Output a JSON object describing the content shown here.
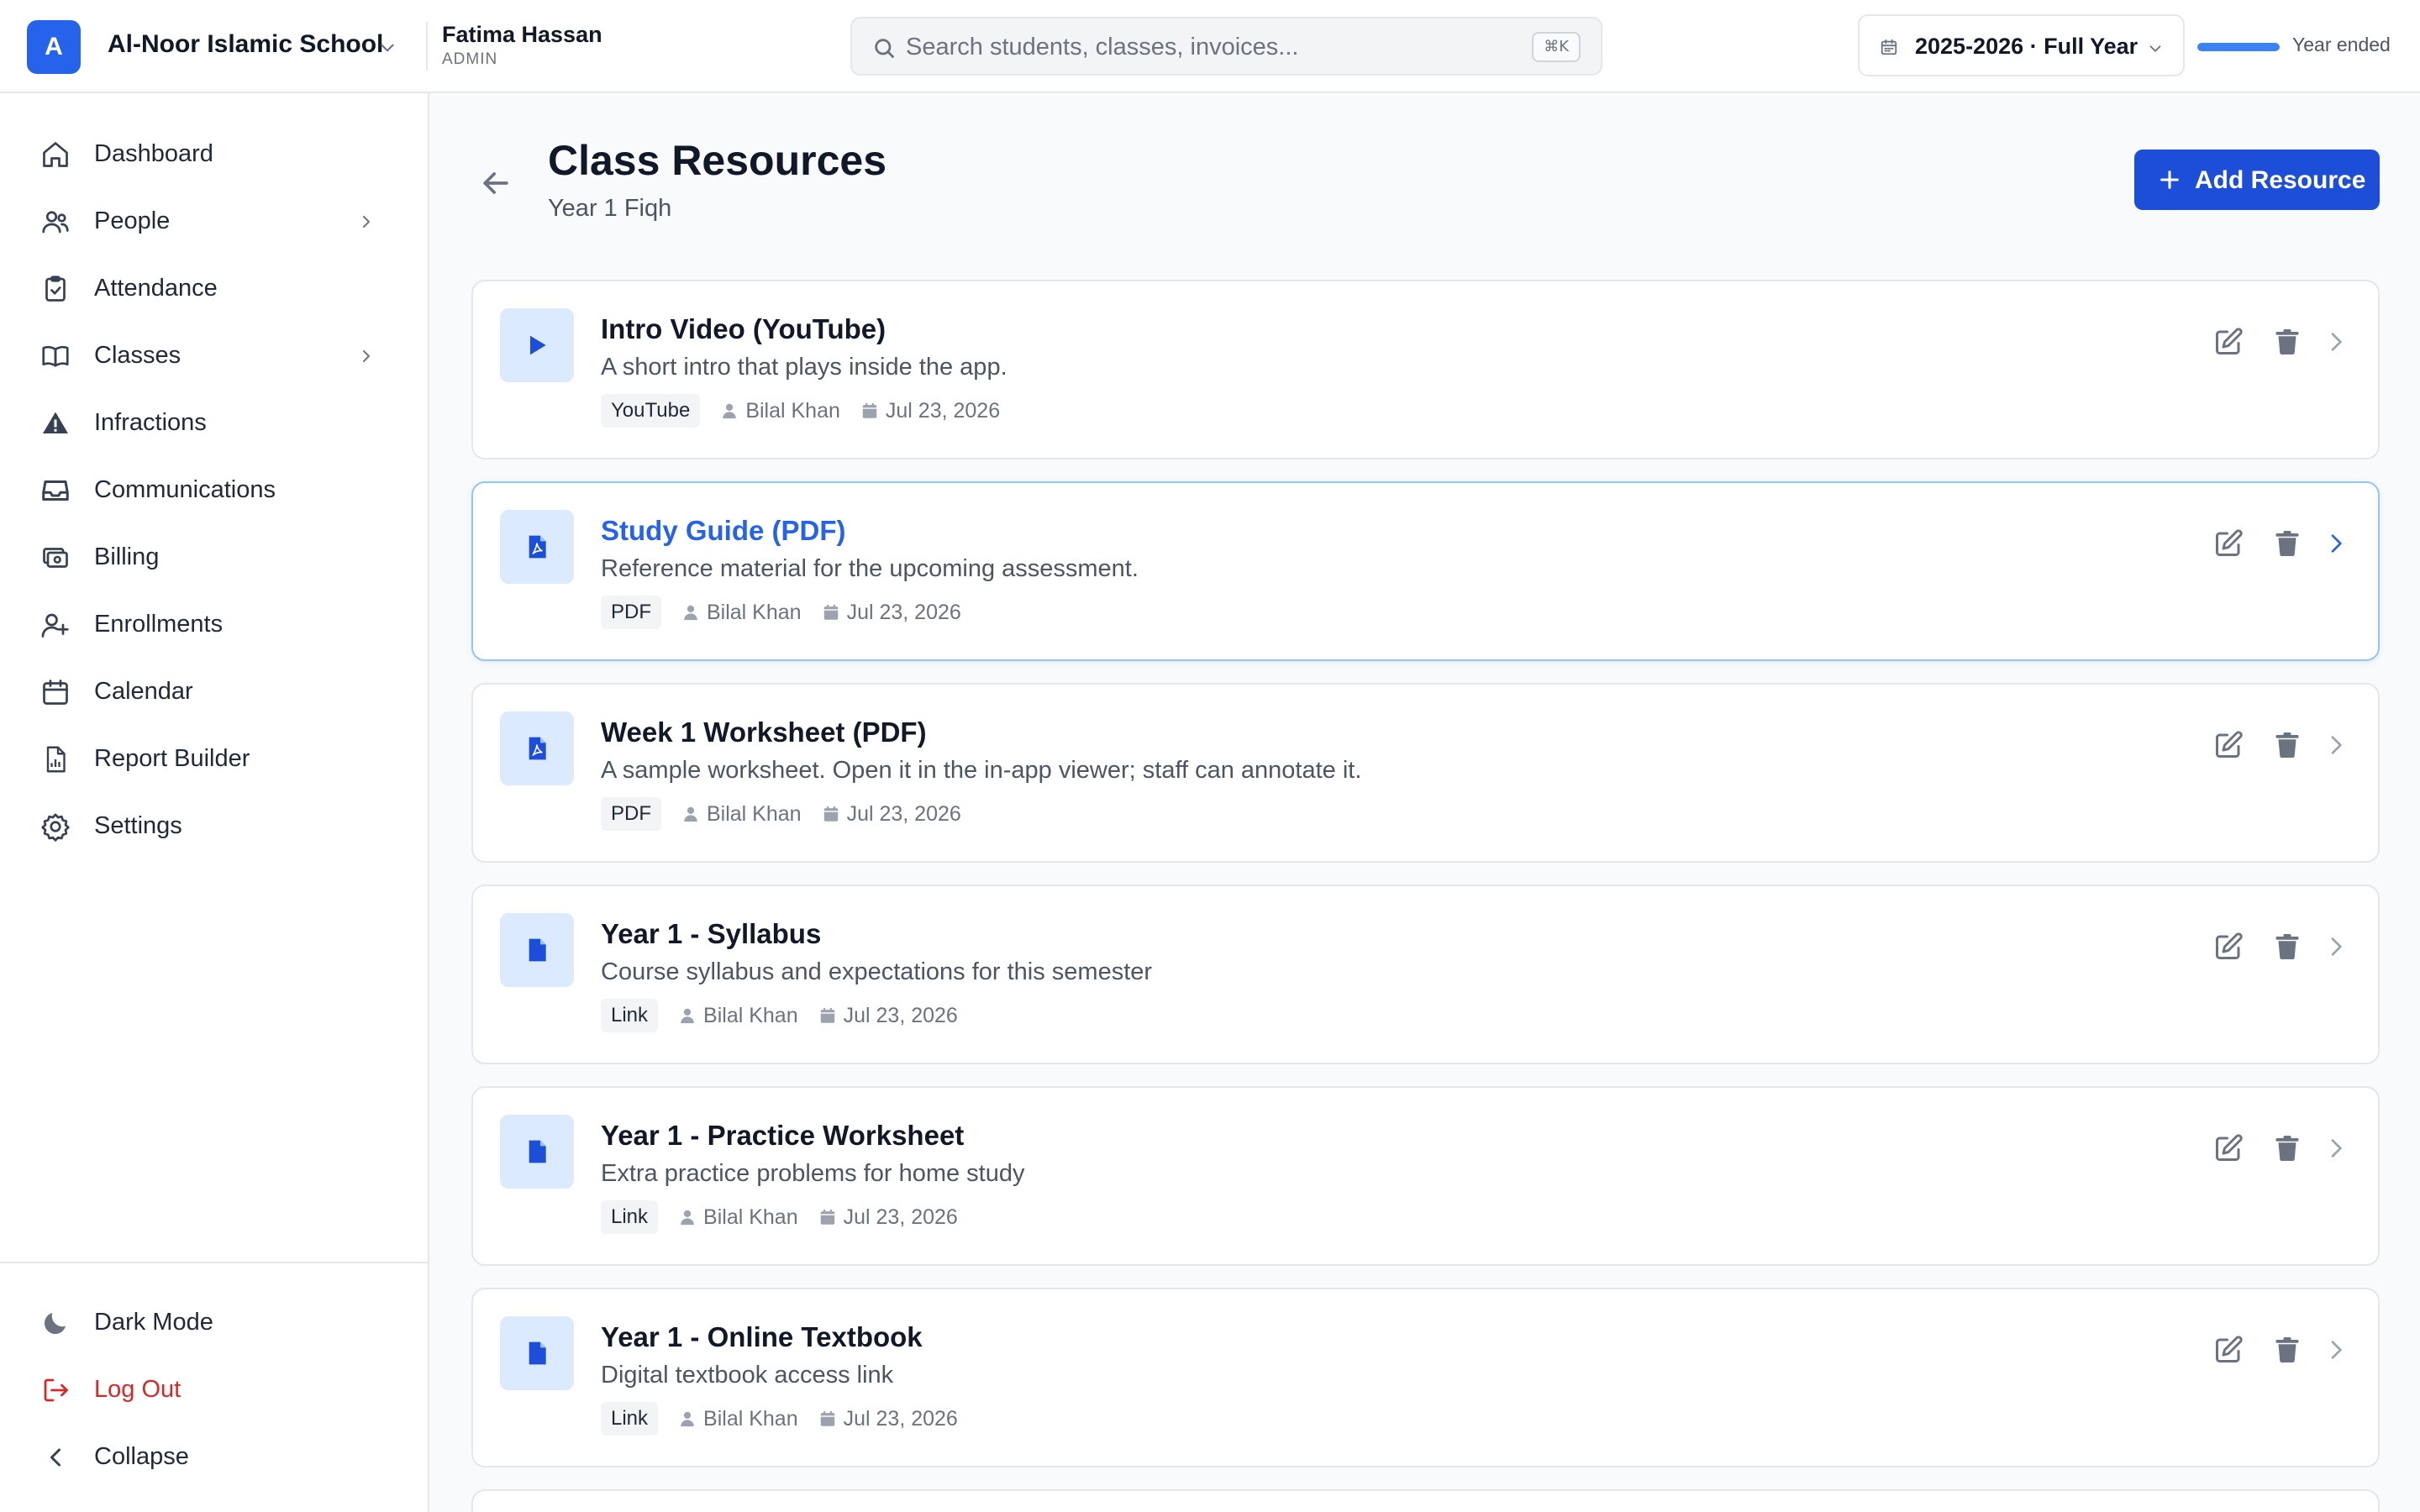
{
  "topbar": {
    "logo_letter": "A",
    "school_name": "Al-Noor Islamic School",
    "user_name": "Fatima Hassan",
    "user_role": "ADMIN",
    "search_placeholder": "Search students, classes, invoices...",
    "search_shortcut": "⌘K",
    "year_selector": "2025-2026 · Full Year",
    "year_progress": 1.0,
    "year_status": "Year ended"
  },
  "sidebar": {
    "items": [
      {
        "label": "Dashboard",
        "icon": "home-icon"
      },
      {
        "label": "People",
        "icon": "users-icon"
      },
      {
        "label": "Attendance",
        "icon": "clipboard-check-icon"
      },
      {
        "label": "Classes",
        "icon": "book-icon"
      },
      {
        "label": "Infractions",
        "icon": "warning-icon"
      },
      {
        "label": "Communications",
        "icon": "inbox-icon"
      },
      {
        "label": "Billing",
        "icon": "billing-icon"
      },
      {
        "label": "Enrollments",
        "icon": "user-plus-icon"
      },
      {
        "label": "Calendar",
        "icon": "calendar-icon"
      },
      {
        "label": "Report Builder",
        "icon": "report-icon"
      },
      {
        "label": "Settings",
        "icon": "gear-icon"
      }
    ],
    "bottom": {
      "dark_mode": "Dark Mode",
      "logout": "Log Out",
      "collapse": "Collapse"
    }
  },
  "main": {
    "title": "Class Resources",
    "subtitle": "Year 1 Fiqh",
    "add_button": "Add Resource",
    "resources": [
      {
        "title": "Intro Video (YouTube)",
        "description": "A short intro that plays inside the app.",
        "type": "YouTube",
        "icon": "play-icon",
        "author": "Bilal Khan",
        "date": "Jul 23, 2026"
      },
      {
        "title": "Study Guide (PDF)",
        "description": "Reference material for the upcoming assessment.",
        "type": "PDF",
        "icon": "pdf-icon",
        "author": "Bilal Khan",
        "date": "Jul 23, 2026"
      },
      {
        "title": "Week 1 Worksheet (PDF)",
        "description": "A sample worksheet. Open it in the in-app viewer; staff can annotate it.",
        "type": "PDF",
        "icon": "pdf-icon",
        "author": "Bilal Khan",
        "date": "Jul 23, 2026"
      },
      {
        "title": "Year 1 - Syllabus",
        "description": "Course syllabus and expectations for this semester",
        "type": "Link",
        "icon": "file-icon",
        "author": "Bilal Khan",
        "date": "Jul 23, 2026"
      },
      {
        "title": "Year 1 - Practice Worksheet",
        "description": "Extra practice problems for home study",
        "type": "Link",
        "icon": "file-icon",
        "author": "Bilal Khan",
        "date": "Jul 23, 2026"
      },
      {
        "title": "Year 1 - Online Textbook",
        "description": "Digital textbook access link",
        "type": "Link",
        "icon": "file-icon",
        "author": "Bilal Khan",
        "date": "Jul 23, 2026"
      }
    ]
  },
  "colors": {
    "accent": "#2563eb",
    "danger": "#dc2626",
    "icon_bg": "#dbeafe"
  }
}
